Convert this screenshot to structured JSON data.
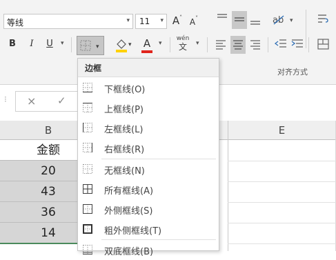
{
  "ribbon": {
    "font_name": "等线",
    "font_size": "11",
    "grow_font": "A",
    "shrink_font": "A",
    "bold": "B",
    "italic": "I",
    "underline": "U",
    "font_color": "A",
    "phonetic": "wén",
    "phonetic_sub": "文",
    "group_label": "对齐方式"
  },
  "formula_bar": {
    "cancel": "×",
    "enter": "✓"
  },
  "columns": {
    "b": "B",
    "e": "E"
  },
  "cells": [
    "金额",
    "20",
    "43",
    "36",
    "14"
  ],
  "menu": {
    "header": "边框",
    "items": [
      {
        "label": "下框线(O)"
      },
      {
        "label": "上框线(P)"
      },
      {
        "label": "左框线(L)"
      },
      {
        "label": "右框线(R)"
      },
      {
        "label": "无框线(N)"
      },
      {
        "label": "所有框线(A)"
      },
      {
        "label": "外侧框线(S)"
      },
      {
        "label": "粗外侧框线(T)"
      },
      {
        "label": "双底框线(B)"
      }
    ]
  }
}
